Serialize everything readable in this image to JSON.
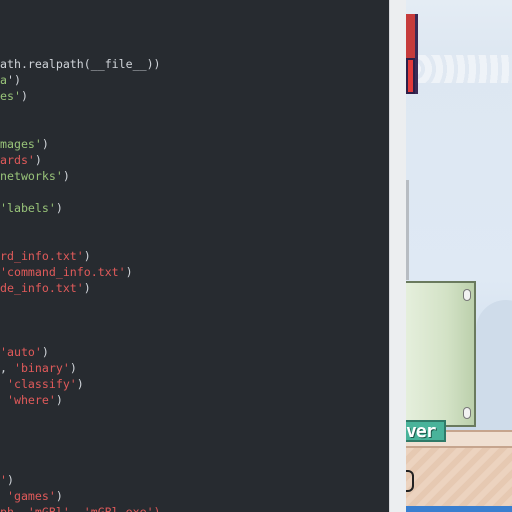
{
  "code_editor": {
    "lines": [
      [
        {
          "t": "ath.realpath(__file__))",
          "c": "w"
        }
      ],
      [
        {
          "t": "a",
          "c": "g"
        },
        {
          "t": "')",
          "c": "w"
        }
      ],
      [
        {
          "t": "es'",
          "c": "g"
        },
        {
          "t": ")",
          "c": "w"
        }
      ],
      [],
      [],
      [
        {
          "t": "mages'",
          "c": "g"
        },
        {
          "t": ")",
          "c": "w"
        }
      ],
      [
        {
          "t": "ards'",
          "c": "r"
        },
        {
          "t": ")",
          "c": "w"
        }
      ],
      [
        {
          "t": "networks'",
          "c": "g"
        },
        {
          "t": ")",
          "c": "w"
        }
      ],
      [],
      [
        {
          "t": "'labels'",
          "c": "g"
        },
        {
          "t": ")",
          "c": "w"
        }
      ],
      [],
      [],
      [
        {
          "t": "rd_info.txt'",
          "c": "r"
        },
        {
          "t": ")",
          "c": "w"
        }
      ],
      [
        {
          "t": "'command_info.txt'",
          "c": "r"
        },
        {
          "t": ")",
          "c": "w"
        }
      ],
      [
        {
          "t": "de_info.txt'",
          "c": "r"
        },
        {
          "t": ")",
          "c": "w"
        }
      ],
      [],
      [],
      [],
      [
        {
          "t": "'auto'",
          "c": "r"
        },
        {
          "t": ")",
          "c": "w"
        }
      ],
      [
        {
          "t": ", ",
          "c": "w"
        },
        {
          "t": "'binary'",
          "c": "r"
        },
        {
          "t": ")",
          "c": "w"
        }
      ],
      [
        {
          "t": " ",
          "c": "w"
        },
        {
          "t": "'classify'",
          "c": "r"
        },
        {
          "t": ")",
          "c": "w"
        }
      ],
      [
        {
          "t": " ",
          "c": "w"
        },
        {
          "t": "'where'",
          "c": "r"
        },
        {
          "t": ")",
          "c": "w"
        }
      ],
      [],
      [],
      [],
      [],
      [
        {
          "t": "'",
          "c": "r"
        },
        {
          "t": ")",
          "c": "w"
        }
      ],
      [
        {
          "t": " ",
          "c": "w"
        },
        {
          "t": "'games'",
          "c": "r"
        },
        {
          "t": ")",
          "c": "w"
        }
      ],
      [
        {
          "t": "ph, 'mGBl', 'mGBl.exe')",
          "c": "r"
        }
      ]
    ]
  },
  "game_view": {
    "banner_text": "ver",
    "colors": {
      "pipe": "#d3e2c6",
      "banner": "#49b39a",
      "ground": "#ecd3bf",
      "sky": "#dfe9f4"
    }
  }
}
